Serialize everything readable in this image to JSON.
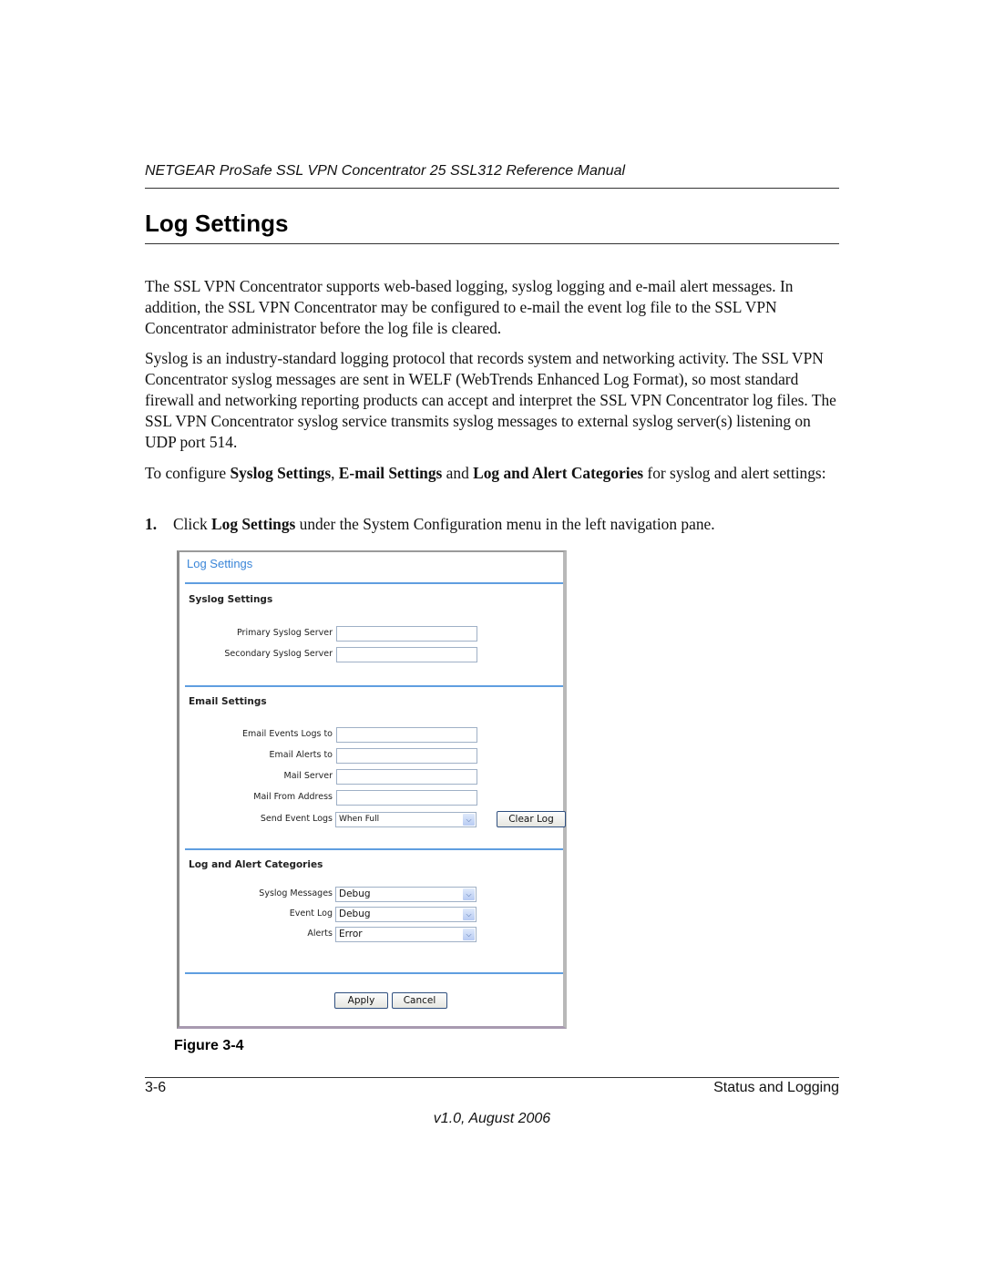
{
  "document": {
    "running_header": "NETGEAR ProSafe SSL VPN Concentrator 25 SSL312 Reference Manual",
    "section_title": "Log Settings",
    "paragraphs": {
      "p1": "The SSL VPN Concentrator supports web-based logging, syslog logging and e-mail alert messages. In addition, the SSL VPN Concentrator may be configured to e-mail the event log file to the SSL VPN Concentrator administrator before the log file is cleared.",
      "p2": "Syslog is an industry-standard logging protocol that records system and networking activity. The SSL VPN Concentrator syslog messages are sent in WELF (WebTrends Enhanced Log Format), so most standard firewall and networking reporting products can accept and interpret the SSL VPN Concentrator log files. The SSL VPN Concentrator syslog service transmits syslog messages to external syslog server(s) listening on UDP port 514.",
      "p3": {
        "t1": "To configure ",
        "b1": "Syslog Settings",
        "t2": ", ",
        "b2": "E-mail Settings",
        "t3": " and ",
        "b3": "Log and Alert Categories",
        "t4": " for syslog and alert settings:"
      }
    },
    "steps": [
      {
        "number": "1.",
        "t1": "Click ",
        "b1": "Log Settings",
        "t2": " under the System Configuration menu in the left navigation pane."
      }
    ],
    "figure_caption": "Figure 3-4",
    "footer": {
      "page_number": "3-6",
      "chapter": "Status and Logging",
      "version": "v1.0, August 2006"
    }
  },
  "screenshot": {
    "title": "Log Settings",
    "title_color": "#3b86d8",
    "syslog_settings": {
      "heading": "Syslog Settings",
      "fields": [
        {
          "label": "Primary Syslog Server",
          "value": ""
        },
        {
          "label": "Secondary Syslog Server",
          "value": ""
        }
      ]
    },
    "email_settings": {
      "heading": "Email Settings",
      "fields": [
        {
          "label": "Email Events Logs to",
          "value": ""
        },
        {
          "label": "Email Alerts to",
          "value": ""
        },
        {
          "label": "Mail Server",
          "value": ""
        },
        {
          "label": "Mail From Address",
          "value": ""
        }
      ],
      "send_event_logs": {
        "label": "Send Event Logs",
        "value": "When Full"
      },
      "clear_log_button": "Clear Log"
    },
    "log_alert_categories": {
      "heading": "Log and Alert Categories",
      "fields": [
        {
          "label": "Syslog Messages",
          "value": "Debug"
        },
        {
          "label": "Event Log",
          "value": "Debug"
        },
        {
          "label": "Alerts",
          "value": "Error"
        }
      ]
    },
    "buttons": {
      "apply": "Apply",
      "cancel": "Cancel"
    }
  }
}
